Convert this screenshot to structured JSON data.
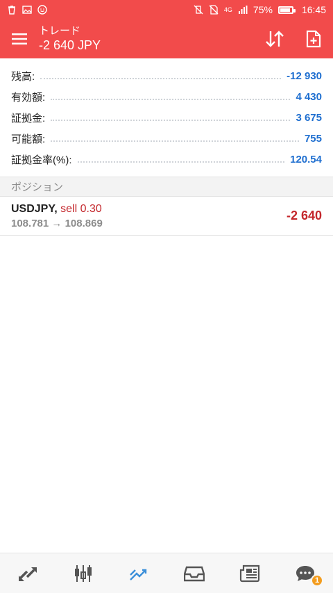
{
  "status_bar": {
    "battery_text": "75%",
    "battery_level": 0.75,
    "time": "16:45",
    "network": "4G"
  },
  "header": {
    "title": "トレード",
    "subtitle": "-2 640 JPY"
  },
  "summary": [
    {
      "label": "残高:",
      "value": "-12 930"
    },
    {
      "label": "有効額:",
      "value": "4 430"
    },
    {
      "label": "証拠金:",
      "value": "3 675"
    },
    {
      "label": "可能額:",
      "value": "755"
    },
    {
      "label": "証拠金率(%):",
      "value": "120.54"
    }
  ],
  "section_title": "ポジション",
  "position": {
    "symbol": "USDJPY,",
    "type": "sell 0.30",
    "price_open": "108.781",
    "arrow": "→",
    "price_current": "108.869",
    "profit": "-2 640"
  },
  "bottom_nav": {
    "chat_badge": "1"
  },
  "colors": {
    "accent": "#f24b4b",
    "value_blue": "#1f6fd0",
    "loss_red": "#c4282d",
    "active_tab": "#3b8fd9"
  }
}
